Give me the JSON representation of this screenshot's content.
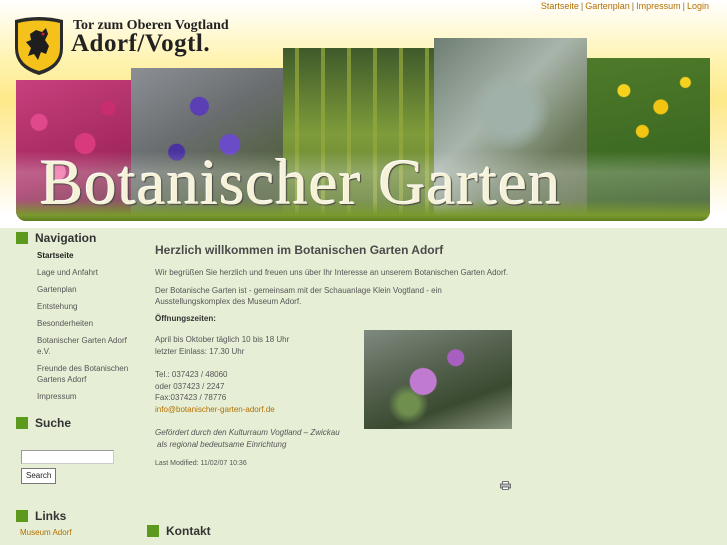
{
  "top_links": [
    "Startseite",
    "Gartenplan",
    "Impressum",
    "Login"
  ],
  "header": {
    "town_line1": "Tor zum Oberen Vogtland",
    "town_line2": "Adorf/Vogtl.",
    "banner_title": "Botanischer Garten"
  },
  "sidebar": {
    "navigation_title": "Navigation",
    "nav_items": [
      {
        "label": "Startseite",
        "active": true
      },
      {
        "label": "Lage und Anfahrt"
      },
      {
        "label": "Gartenplan"
      },
      {
        "label": "Entstehung"
      },
      {
        "label": "Besonderheiten"
      },
      {
        "label": "Botanischer Garten Adorf e.V."
      },
      {
        "label": "Freunde des Botanischen Gartens Adorf"
      },
      {
        "label": "Impressum"
      }
    ],
    "search_title": "Suche",
    "search_value": "",
    "search_button": "Search",
    "links_title": "Links",
    "links": [
      "Museum Adorf"
    ]
  },
  "main": {
    "title": "Herzlich willkommen im Botanischen Garten Adorf",
    "intro": "Wir begrüßen Sie herzlich und freuen uns über Ihr Interesse an unserem Botanischen Garten Adorf.",
    "description": "Der Botanische Garten ist - gemeinsam mit der Schauanlage Klein Vogtland - ein Ausstellungskomplex des Museum Adorf.",
    "hours_title": "Öffnungszeiten:",
    "hours_1": "April bis Oktober täglich 10 bis 18 Uhr",
    "hours_2": "letzter Einlass: 17.30 Uhr",
    "phone_1": "Tel.: 037423 / 48060",
    "phone_2": "oder 037423 / 2247",
    "fax": "Fax:037423 / 78776",
    "email": "info@botanischer-garten-adorf.de",
    "funding_1": "Gefördert durch den Kulturraum Vogtland – Zwickau",
    "funding_2": "als regional bedeutsame Einrichtung",
    "last_modified": "Last Modified: 11/02/07 10:36"
  },
  "contact_title": "Kontakt"
}
